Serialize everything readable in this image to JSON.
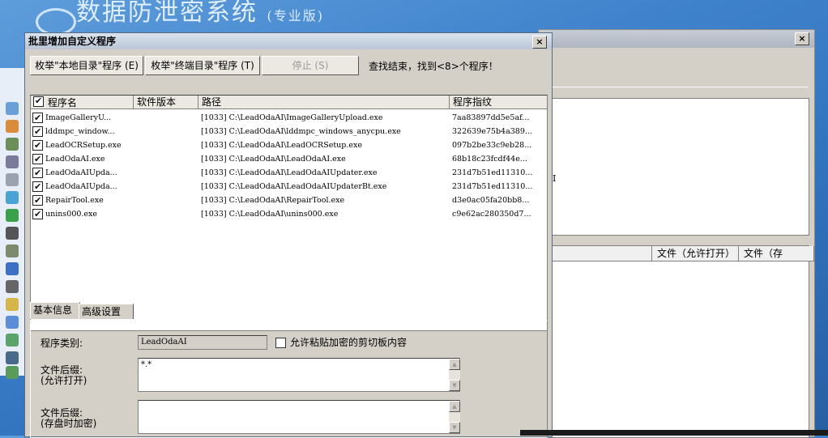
{
  "background": {
    "app_title": "数据防泄密系统",
    "app_edition": "(专业版)",
    "right_window": {
      "columns": [
        "文件（允许打开）",
        "文件（存"
      ],
      "fragment": "I"
    }
  },
  "dialog": {
    "title": "批里增加自定义程序",
    "buttons": {
      "enum_local": "枚举\"本地目录\"程序 (E)",
      "enum_remote": "枚举\"终端目录\"程序 (T)",
      "stop": "停止 (S)"
    },
    "status": "查找结束，找到<8>个程序！",
    "columns": {
      "name": "程序名",
      "version": "软件版本",
      "path": "路径",
      "fingerprint": "程序指纹"
    },
    "rows": [
      {
        "name": "ImageGalleryU...",
        "version": "",
        "path": "[1033] C:\\LeadOdaAI\\ImageGalleryUpload.exe",
        "fingerprint": "7aa83897dd5e5af..."
      },
      {
        "name": "lddmpc_window...",
        "version": "",
        "path": "[1033] C:\\LeadOdaAI\\lddmpc_windows_anycpu.exe",
        "fingerprint": "322639e75b4a389..."
      },
      {
        "name": "LeadOCRSetup.exe",
        "version": "",
        "path": "[1033] C:\\LeadOdaAI\\LeadOCRSetup.exe",
        "fingerprint": "097b2be33c9eb28..."
      },
      {
        "name": "LeadOdaAI.exe",
        "version": "",
        "path": "[1033] C:\\LeadOdaAI\\LeadOdaAI.exe",
        "fingerprint": "68b18c23fcdf44e..."
      },
      {
        "name": "LeadOdaAIUpda...",
        "version": "",
        "path": "[1033] C:\\LeadOdaAI\\LeadOdaAIUpdater.exe",
        "fingerprint": "231d7b51ed11310..."
      },
      {
        "name": "LeadOdaAIUpda...",
        "version": "",
        "path": "[1033] C:\\LeadOdaAI\\LeadOdaAIUpdaterBt.exe",
        "fingerprint": "231d7b51ed11310..."
      },
      {
        "name": "RepairTool.exe",
        "version": "",
        "path": "[1033] C:\\LeadOdaAI\\RepairTool.exe",
        "fingerprint": "d3e0ac05fa20bb8..."
      },
      {
        "name": "unins000.exe",
        "version": "",
        "path": "[1033] C:\\LeadOdaAI\\unins000.exe",
        "fingerprint": "c9e62ac280350d7..."
      }
    ],
    "tabs": [
      "基本信息",
      "高级设置"
    ],
    "form": {
      "type_label": "程序类别:",
      "type_value": "LeadOdaAI",
      "clipboard_label": "允许粘贴加密的剪切板内容",
      "suffix_open_label_1": "文件后缀:",
      "suffix_open_label_2": "(允许打开)",
      "suffix_open_value": "*.*",
      "suffix_save_label_1": "文件后缀:",
      "suffix_save_label_2": "(存盘时加密)",
      "suffix_save_value": ""
    }
  },
  "colors": {
    "desktop_blue": "#3f82cc",
    "dialog_face": "#d4d0c8"
  }
}
